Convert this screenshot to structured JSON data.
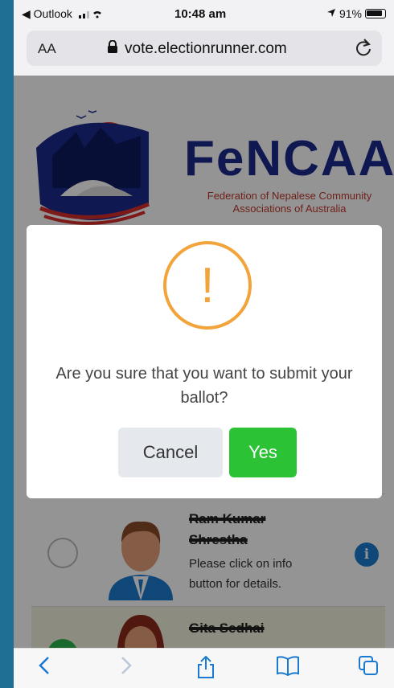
{
  "status": {
    "back_label": "◀ Outlook",
    "time": "10:48 am",
    "battery": "91%"
  },
  "browser": {
    "text_size_label": "AA",
    "url": "vote.electionrunner.com"
  },
  "org": {
    "acronym": "FeNCAA",
    "full_name": "Federation of Nepalese Community Associations of Australia"
  },
  "dialog": {
    "icon": "exclamation-icon",
    "question": "Are you sure that you want to submit your ballot?",
    "cancel_label": "Cancel",
    "yes_label": "Yes"
  },
  "candidates": [
    {
      "name_line1": "Ram Kumar",
      "name_line2": "Shrestha",
      "description": "Please click on info button for details.",
      "selected": false
    },
    {
      "name_line1": "Gita Sedhai",
      "selected": true
    }
  ],
  "colors": {
    "accent_blue": "#1a7ad0",
    "warning_orange": "#f2a43a",
    "confirm_green": "#2bc236",
    "brand_navy": "#1c2a8c",
    "brand_red": "#c0392b"
  }
}
